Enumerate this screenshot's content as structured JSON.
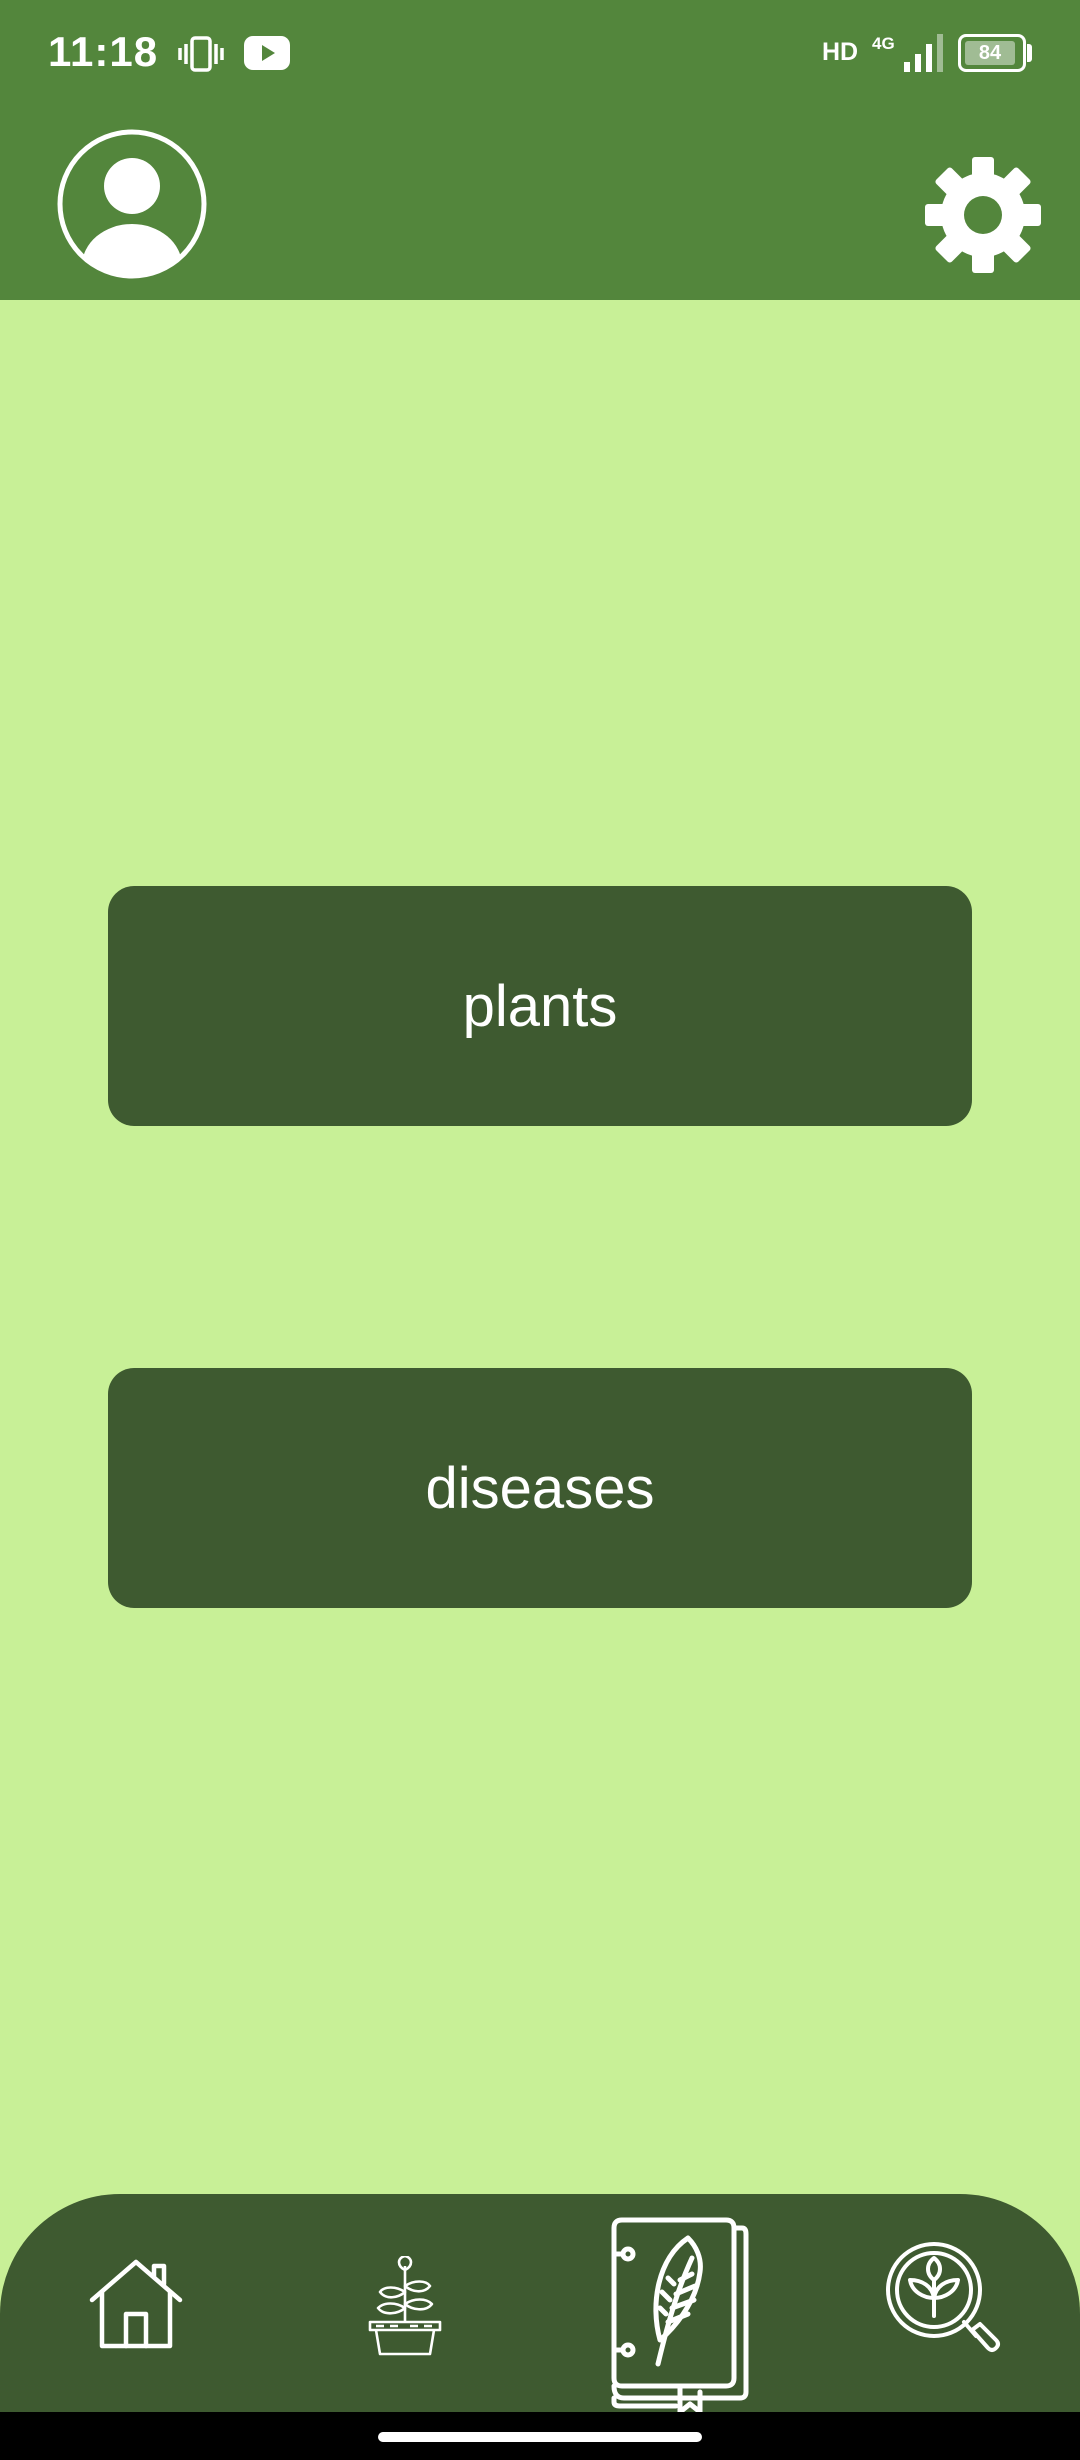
{
  "status_bar": {
    "time": "11:18",
    "hd_label": "HD",
    "network_label": "4G",
    "battery_level": "84",
    "icons": [
      "vibrate-icon",
      "youtube-icon",
      "signal-icon",
      "battery-icon"
    ]
  },
  "header": {
    "profile_icon": "person-circle-icon",
    "settings_icon": "gear-icon"
  },
  "main": {
    "plants_label": "plants",
    "diseases_label": "diseases"
  },
  "bottom_nav": {
    "items": [
      {
        "icon": "home-icon",
        "active": false
      },
      {
        "icon": "potted-plant-icon",
        "active": false
      },
      {
        "icon": "leaf-book-icon",
        "active": true
      },
      {
        "icon": "plant-search-icon",
        "active": false
      }
    ]
  },
  "colors": {
    "header_bg": "#53863c",
    "page_bg": "#c8f097",
    "button_bg": "#3e5a30",
    "nav_bg": "#3e5a30",
    "text": "#ffffff"
  }
}
